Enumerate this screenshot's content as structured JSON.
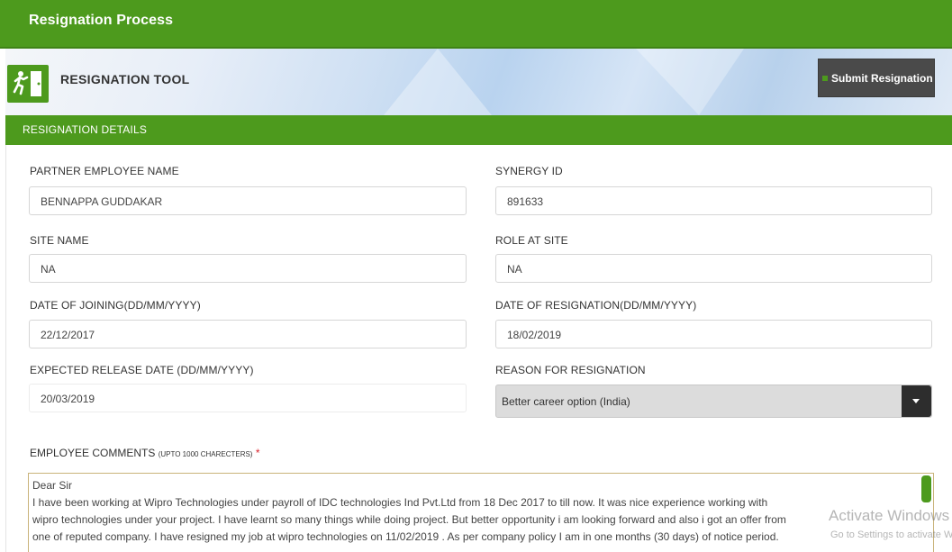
{
  "header": {
    "title": "Resignation Process"
  },
  "tool": {
    "icon": "exit-icon",
    "title": "RESIGNATION TOOL",
    "submit_label": "Submit Resignation"
  },
  "section": {
    "title": "RESIGNATION DETAILS"
  },
  "form": {
    "partner_employee_name": {
      "label": "PARTNER EMPLOYEE NAME",
      "value": "BENNAPPA GUDDAKAR"
    },
    "synergy_id": {
      "label": "SYNERGY ID",
      "value": "891633"
    },
    "site_name": {
      "label": "SITE NAME",
      "value": "NA"
    },
    "role_at_site": {
      "label": "ROLE AT SITE",
      "value": "NA"
    },
    "date_of_joining": {
      "label": "DATE OF JOINING(DD/MM/YYYY)",
      "value": "22/12/2017"
    },
    "date_of_resignation": {
      "label": "DATE OF RESIGNATION(DD/MM/YYYY)",
      "value": "18/02/2019"
    },
    "expected_release_date": {
      "label": "EXPECTED RELEASE DATE (DD/MM/YYYY)",
      "value": "20/03/2019"
    },
    "reason_for_resignation": {
      "label": "REASON FOR RESIGNATION",
      "value": "Better career option (India)"
    },
    "comments": {
      "label": "EMPLOYEE COMMENTS",
      "hint": "(UPTO 1000 CHARECTERS)",
      "required_mark": "*",
      "lines": [
        "Dear Sir",
        "I have been working at Wipro Technologies under payroll of IDC technologies Ind Pvt.Ltd from 18 Dec 2017 to till now. It was nice experience working with",
        "wipro technologies under your project. I have learnt so many things while doing project. But better opportunity i am looking forward and also i got an offer from",
        "one of reputed company. I have resigned my job at wipro technologies on 11/02/2019 . As per company policy I am in one months (30 days) of notice period."
      ]
    }
  },
  "watermark": {
    "line1": "Activate Windows",
    "line2": "Go to Settings to activate Windows."
  },
  "colors": {
    "brand_green": "#4d9a1d",
    "dark_button": "#4a4a4a",
    "required_red": "#d9232d"
  }
}
